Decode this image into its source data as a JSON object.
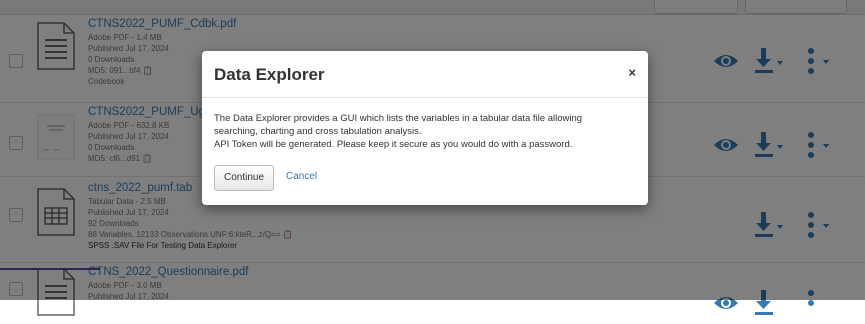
{
  "files": [
    {
      "title": "CTNS2022_PUMF_Cdbk.pdf",
      "type_size": "Adobe PDF - 1.4 MB",
      "published": "Published Jul 17, 2024",
      "downloads": "0 Downloads",
      "checksum": "MD5: 091...bf4",
      "tag": "Codebook",
      "icon": "pdf-document-icon",
      "show_preview": true
    },
    {
      "title": "CTNS2022_PUMF_UgE...",
      "type_size": "Adobe PDF - 632.8 KB",
      "published": "Published Jul 17, 2024",
      "downloads": "0 Downloads",
      "checksum": "MD5: cf6...d91",
      "icon": "pdf-thumbnail-icon",
      "show_preview": true
    },
    {
      "title": "ctns_2022_pumf.tab",
      "type_size": "Tabular Data - 2.5 MB",
      "published": "Published Jul 17, 2024",
      "downloads": "92 Downloads",
      "unf": "88 Variables, 12133 Observations UNF:6:kteR...z/Q==",
      "description": "SPSS .SAV File For Testing Data Explorer",
      "icon": "tabular-data-icon",
      "show_preview": false
    },
    {
      "title": "CTNS_2022_Questionnaire.pdf",
      "type_size": "Adobe PDF - 3.0 MB",
      "published": "Published Jul 17, 2024",
      "icon": "pdf-document-icon",
      "show_preview": true
    }
  ],
  "modal": {
    "title": "Data Explorer",
    "close": "×",
    "body_line1": "The Data Explorer provides a GUI which lists the variables in a tabular data file allowing",
    "body_line2": "searching, charting and cross tabulation analysis.",
    "body_line3": "API Token will be generated. Please keep it secure as you would do with a password.",
    "continue_label": "Continue",
    "cancel_label": "Cancel"
  },
  "colors": {
    "link": "#337ab7",
    "overlay": "rgba(0,0,0,0.5)"
  }
}
